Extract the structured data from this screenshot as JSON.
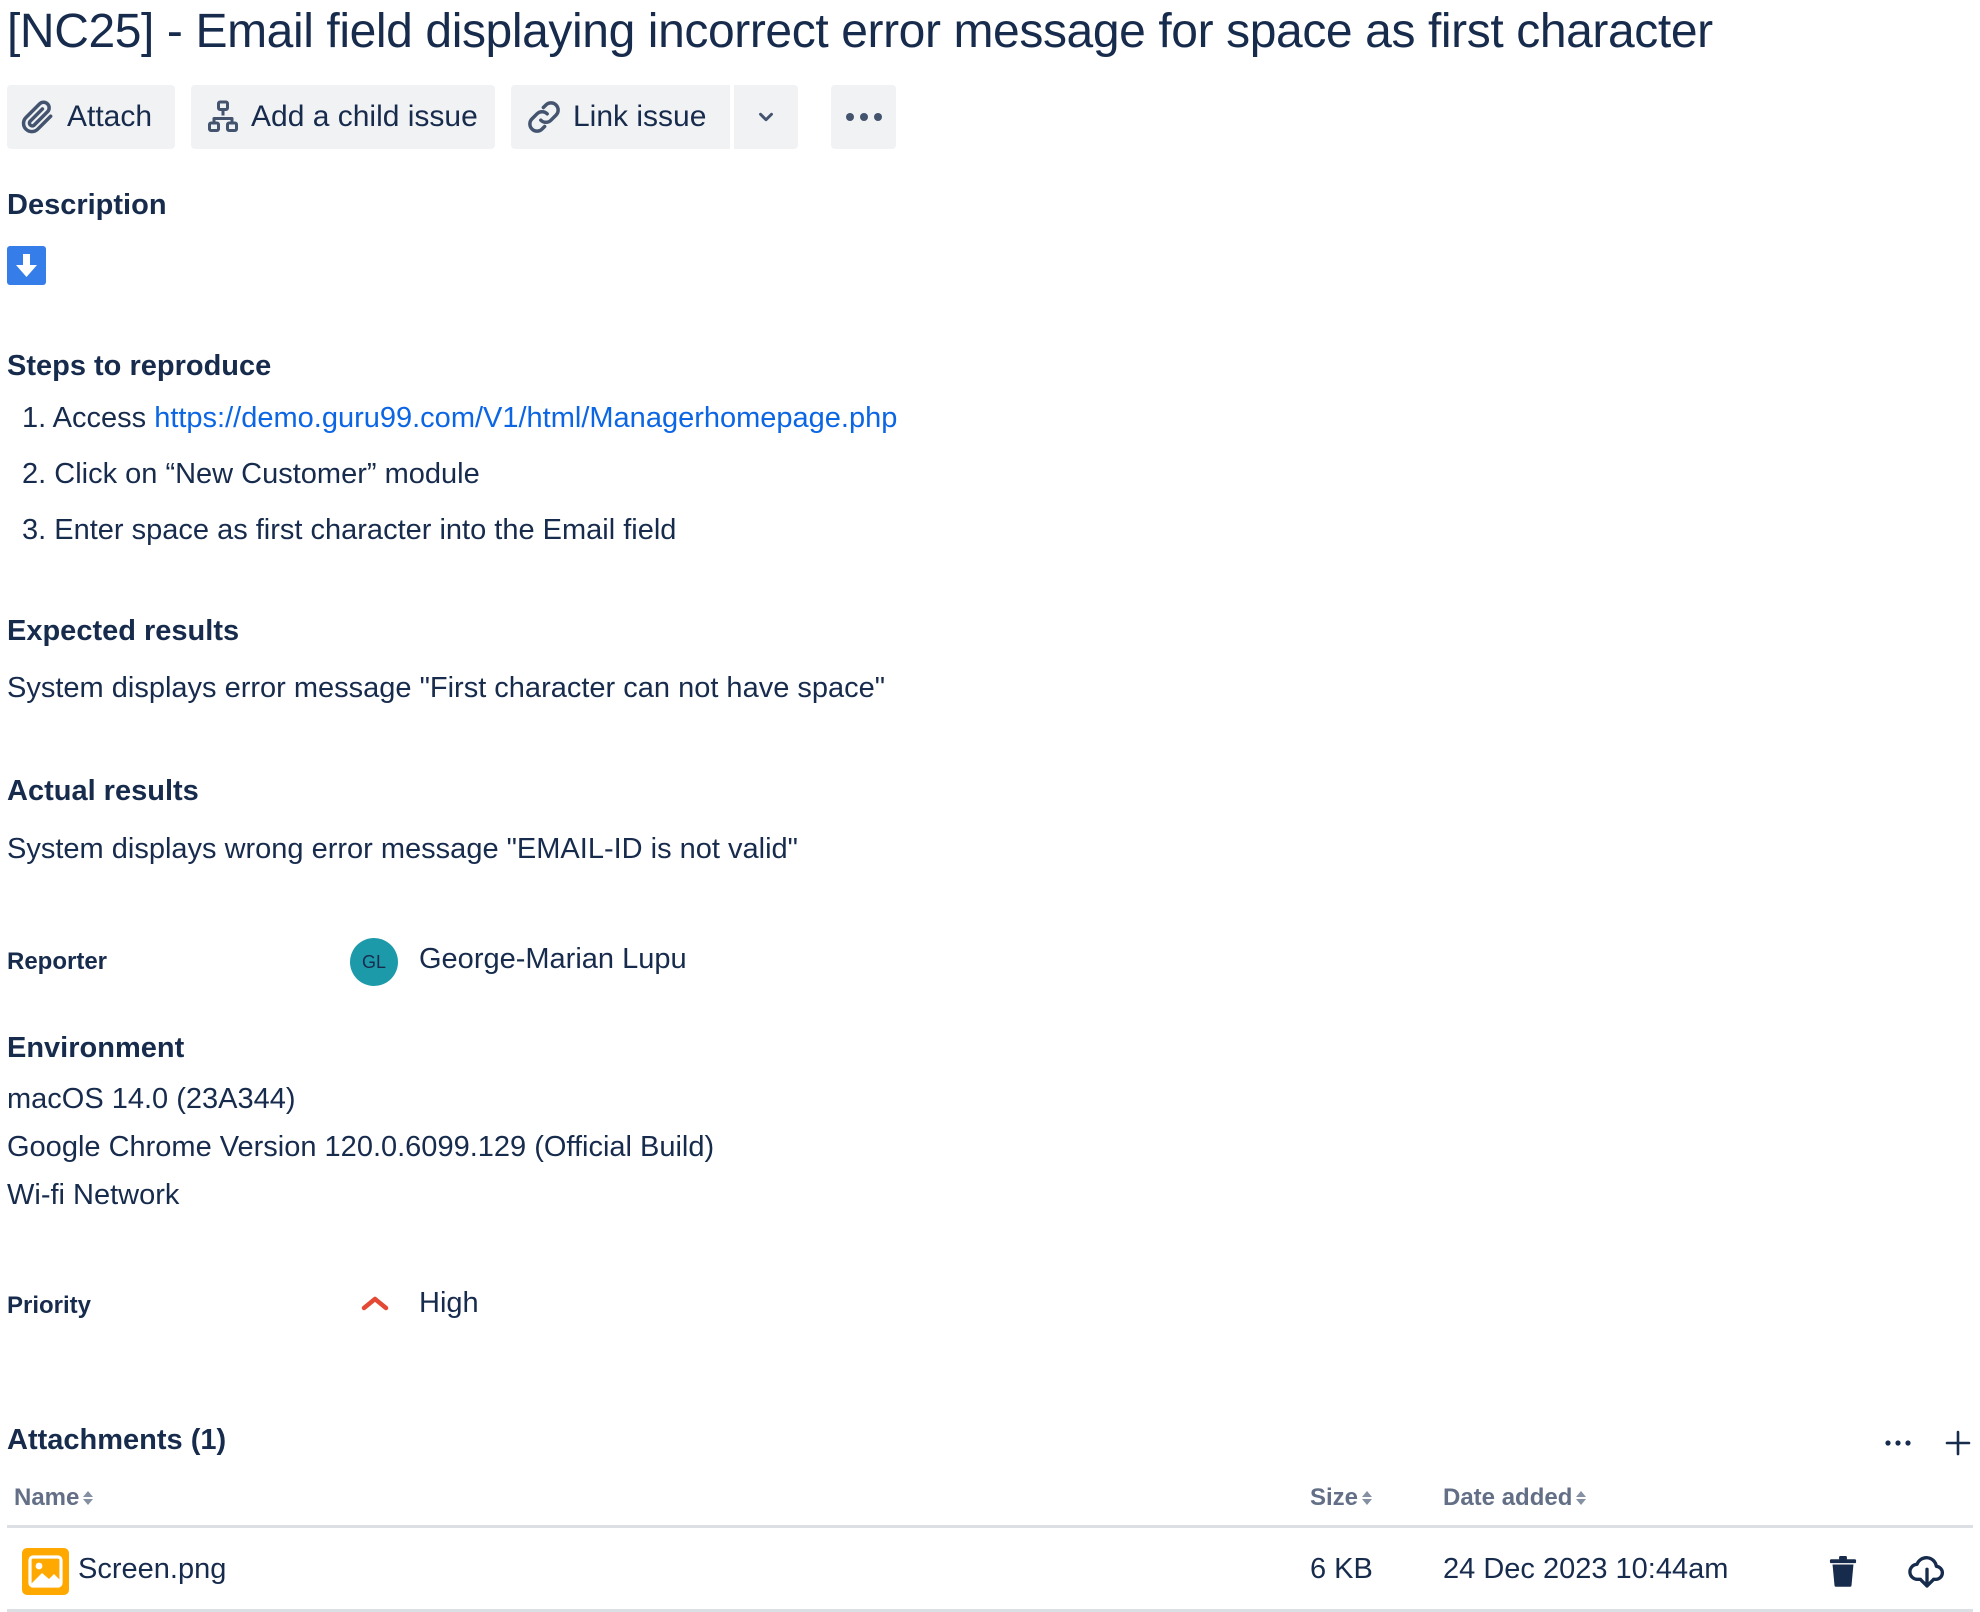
{
  "issue": {
    "title": "[NC25] - Email field displaying incorrect error message for space as first character"
  },
  "toolbar": {
    "attach_label": "Attach",
    "child_issue_label": "Add a child issue",
    "link_issue_label": "Link issue"
  },
  "description": {
    "heading": "Description",
    "steps_heading": "Steps to reproduce",
    "steps": [
      {
        "num": "1.",
        "prefix": "Access ",
        "link": "https://demo.guru99.com/V1/html/Managerhomepage.php"
      },
      {
        "num": "2.",
        "text": "Click on “New Customer” module"
      },
      {
        "num": "3.",
        "text": "Enter space as first character into the Email field"
      }
    ],
    "expected_heading": "Expected results",
    "expected_text": "System displays error message \"First character can not have space\"",
    "actual_heading": "Actual results",
    "actual_text": "System displays wrong error message \"EMAIL-ID is not valid\""
  },
  "reporter": {
    "label": "Reporter",
    "initials": "GL",
    "name": "George-Marian Lupu",
    "avatar_color": "#1D9AAA"
  },
  "environment": {
    "heading": "Environment",
    "lines": [
      "macOS 14.0 (23A344)",
      "Google Chrome Version 120.0.6099.129 (Official Build)",
      "Wi-fi Network"
    ]
  },
  "priority": {
    "label": "Priority",
    "value": "High",
    "color": "#E34935"
  },
  "attachments": {
    "heading": "Attachments (1)",
    "columns": {
      "name": "Name",
      "size": "Size",
      "date": "Date added"
    },
    "rows": [
      {
        "name": "Screen.png",
        "size": "6 KB",
        "date": "24 Dec 2023 10:44am"
      }
    ]
  },
  "colors": {
    "text": "#172B4D",
    "link": "#0C66E4",
    "button_bg": "#F1F2F4",
    "info_blue": "#357DE8",
    "image_icon": "#FFA900"
  }
}
